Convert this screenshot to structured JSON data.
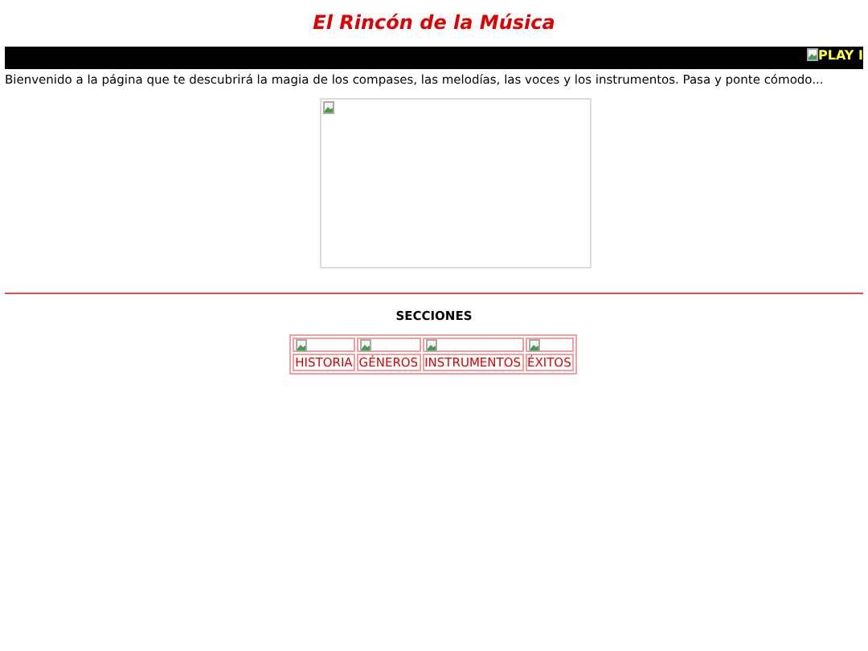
{
  "title": "El Rincón de la Música",
  "banner": {
    "alt_text": "PLAY I"
  },
  "intro": "Bienvenido a la página que te descubrirá la magia de los compases, las melodías, las voces y los instrumentos. Pasa y ponte cómodo...",
  "sections": {
    "heading": "SECCIONES",
    "items": [
      {
        "label": "HISTORIA"
      },
      {
        "label": "GÉNEROS"
      },
      {
        "label": "INSTRUMENTOS"
      },
      {
        "label": "ÉXITOS"
      }
    ]
  }
}
